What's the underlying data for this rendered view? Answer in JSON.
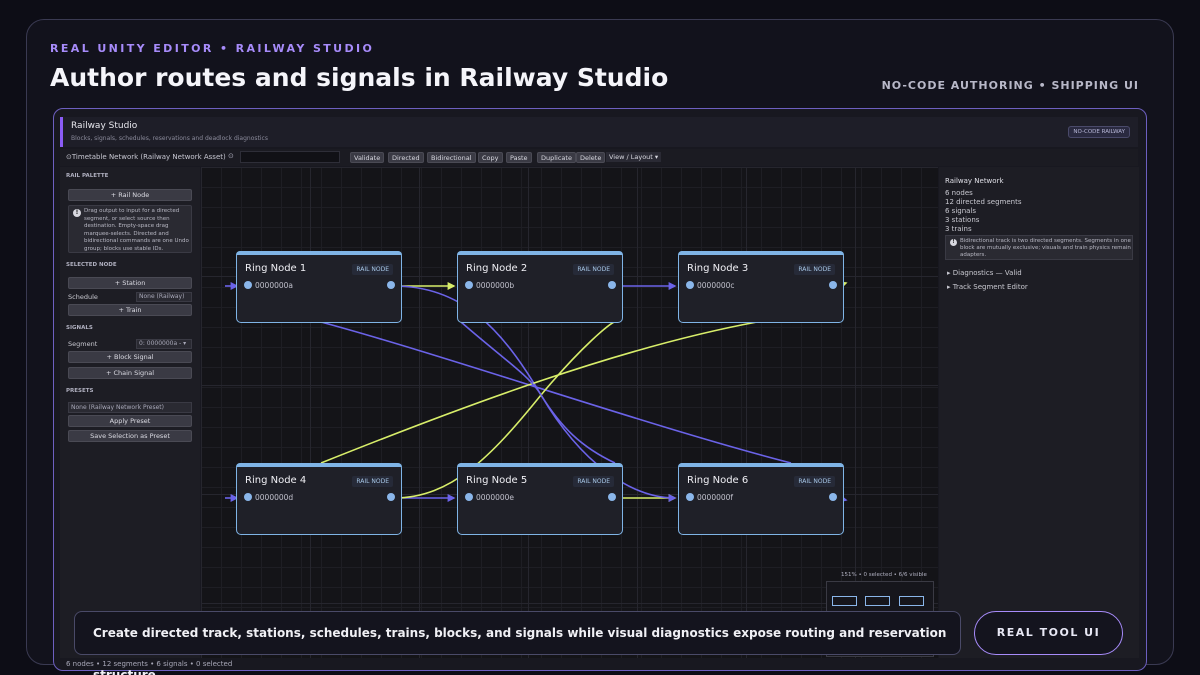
{
  "header": {
    "eyebrow": "REAL UNITY EDITOR • RAILWAY STUDIO",
    "title": "Author routes and signals in Railway Studio",
    "tagline": "NO-CODE AUTHORING • SHIPPING UI"
  },
  "window": {
    "title": "Railway Studio",
    "subtitle": "Blocks, signals, schedules, reservations and deadlock diagnostics",
    "badge": "NO-CODE RAILWAY"
  },
  "toolbar": {
    "asset": "⊙Timetable Network (Railway Network Asset)",
    "search_value": "",
    "buttons": [
      "Validate",
      "Directed",
      "Bidirectional",
      "Copy",
      "Paste",
      "Duplicate",
      "Delete"
    ],
    "view_menu": "View / Layout ▾"
  },
  "palette": {
    "rail_palette": "RAIL PALETTE",
    "rail_node_button": "+ Rail Node",
    "help_text": "Drag output to input for a directed segment, or select source then destination. Empty-space drag marquee-selects. Directed and bidirectional commands are one Undo group; blocks use stable IDs.",
    "selected_node": "SELECTED NODE",
    "station_button": "+ Station",
    "schedule_label": "Schedule",
    "schedule_value": "None (Railway)",
    "train_button": "+ Train",
    "signals": "SIGNALS",
    "segment_label": "Segment",
    "segment_value": "0: 0000000a - ▾",
    "block_signal_button": "+ Block Signal",
    "chain_signal_button": "+ Chain Signal",
    "presets": "PRESETS",
    "preset_value": "None (Railway Network Preset)",
    "apply_preset_button": "Apply Preset",
    "save_preset_button": "Save Selection as Preset"
  },
  "nodes": [
    {
      "title": "Ring Node 1",
      "badge": "RAIL NODE",
      "id": "0000000a"
    },
    {
      "title": "Ring Node 2",
      "badge": "RAIL NODE",
      "id": "0000000b"
    },
    {
      "title": "Ring Node 3",
      "badge": "RAIL NODE",
      "id": "0000000c"
    },
    {
      "title": "Ring Node 4",
      "badge": "RAIL NODE",
      "id": "0000000d"
    },
    {
      "title": "Ring Node 5",
      "badge": "RAIL NODE",
      "id": "0000000e"
    },
    {
      "title": "Ring Node 6",
      "badge": "RAIL NODE",
      "id": "0000000f"
    }
  ],
  "minimap": {
    "label": "151% • 0 selected • 6/6 visible"
  },
  "inspector": {
    "title": "Railway Network",
    "stats": [
      "6 nodes",
      "12 directed segments",
      "6 signals",
      "3 stations",
      "3 trains"
    ],
    "help_text": "Bidirectional track is two directed segments. Segments in one block are mutually exclusive; visuals and train physics remain adapters.",
    "diagnostics": "Diagnostics — Valid",
    "segment_editor": "Track Segment Editor"
  },
  "status_bar": "6 nodes • 12 segments • 6 signals • 0 selected",
  "caption": "Create directed track, stations, schedules, trains, blocks, and signals while visual diagnostics expose routing and reservation structure.",
  "cta": "REAL TOOL UI",
  "colors": {
    "accent": "#a78bfa",
    "edge_blue": "#6b63e8",
    "edge_yellow": "#d8ee6a",
    "node_border": "#7fb4e6"
  }
}
